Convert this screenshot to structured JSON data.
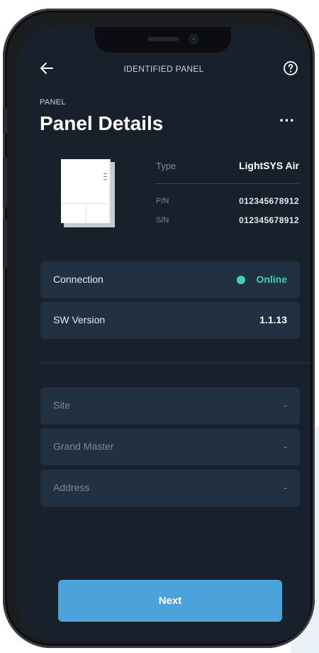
{
  "topbar": {
    "title": "IDENTIFIED PANEL"
  },
  "header": {
    "section_label": "PANEL",
    "title": "Panel Details",
    "more_label": "···"
  },
  "device": {
    "type_label": "Type",
    "type_value": "LightSYS Air",
    "pn_label": "P/N",
    "pn_value": "012345678912",
    "sn_label": "S/N",
    "sn_value": "012345678912"
  },
  "status_cards": [
    {
      "label": "Connection",
      "value": "Online"
    },
    {
      "label": "SW Version",
      "value": "1.1.13"
    }
  ],
  "info_cards": [
    {
      "label": "Site",
      "value": "-"
    },
    {
      "label": "Grand Master",
      "value": "-"
    },
    {
      "label": "Address",
      "value": "-"
    }
  ],
  "footer": {
    "next_label": "Next"
  },
  "colors": {
    "screen_bg": "#17202b",
    "card_bg": "#223141",
    "accent": "#4ca3db",
    "online": "#3fd0b5"
  },
  "icons": {
    "back": "arrow-left-icon",
    "help": "question-circle-icon",
    "more": "more-horizontal-icon"
  }
}
